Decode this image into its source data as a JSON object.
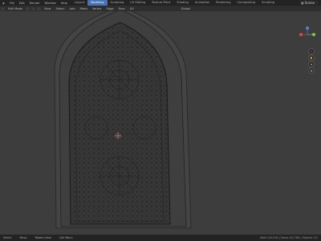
{
  "menu": [
    "File",
    "Edit",
    "Render",
    "Window",
    "Help"
  ],
  "workspace_tabs": [
    {
      "label": "Layout",
      "active": false
    },
    {
      "label": "Modeling",
      "active": true
    },
    {
      "label": "Sculpting",
      "active": false
    },
    {
      "label": "UV Editing",
      "active": false
    },
    {
      "label": "Texture Paint",
      "active": false
    },
    {
      "label": "Shading",
      "active": false
    },
    {
      "label": "Animation",
      "active": false
    },
    {
      "label": "Rendering",
      "active": false
    },
    {
      "label": "Compositing",
      "active": false
    },
    {
      "label": "Scripting",
      "active": false
    }
  ],
  "scene_label": "Scene",
  "header": {
    "mode": "Edit Mode",
    "menus": [
      "View",
      "Select",
      "Add",
      "Mesh",
      "Vertex",
      "Edge",
      "Face",
      "UV"
    ],
    "orientation": "Global"
  },
  "status": {
    "left": [
      "Select",
      "Move",
      "Rotate View",
      "Call Menu"
    ],
    "right": "Verts 0/4,518 | Faces 0/2,764 | Objects 1/1"
  },
  "gizmo": {
    "x_color": "#e8414e",
    "y_color": "#83c446",
    "z_color": "#4a86e8"
  },
  "colors": {
    "accent": "#4772b3",
    "wire": "#1b1b1b",
    "cursor": "#e23b3b"
  }
}
